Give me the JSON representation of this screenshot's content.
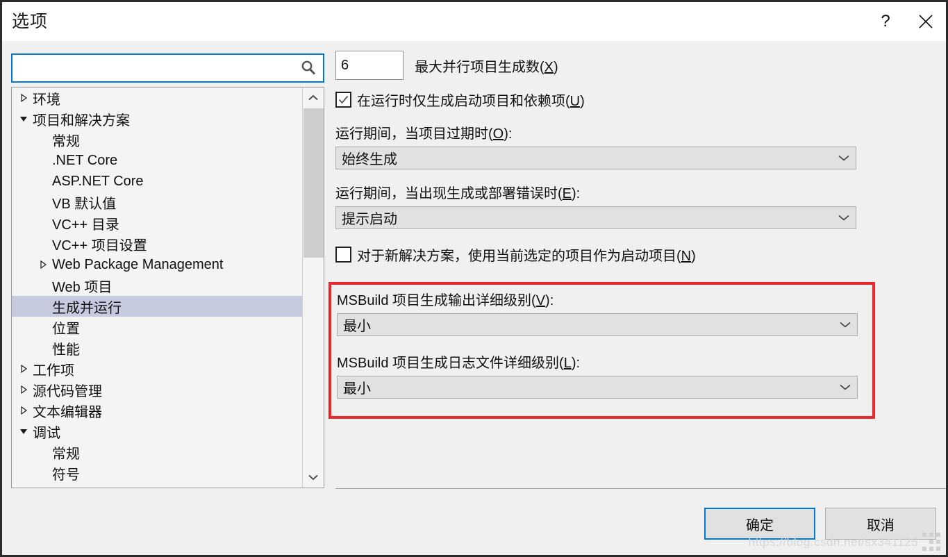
{
  "window": {
    "title": "选项",
    "help_icon": "question-mark-icon",
    "close_icon": "close-icon"
  },
  "search": {
    "value": "",
    "placeholder": "",
    "icon": "search-icon"
  },
  "tree": {
    "items": [
      {
        "label": "环境",
        "level": 0,
        "state": "collapsed",
        "selected": false
      },
      {
        "label": "项目和解决方案",
        "level": 0,
        "state": "expanded",
        "selected": false
      },
      {
        "label": "常规",
        "level": 1,
        "state": "leaf",
        "selected": false
      },
      {
        "label": ".NET Core",
        "level": 1,
        "state": "leaf",
        "selected": false
      },
      {
        "label": "ASP.NET Core",
        "level": 1,
        "state": "leaf",
        "selected": false
      },
      {
        "label": "VB 默认值",
        "level": 1,
        "state": "leaf",
        "selected": false
      },
      {
        "label": "VC++ 目录",
        "level": 1,
        "state": "leaf",
        "selected": false
      },
      {
        "label": "VC++ 项目设置",
        "level": 1,
        "state": "leaf",
        "selected": false
      },
      {
        "label": "Web Package Management",
        "level": 1,
        "state": "collapsed",
        "selected": false
      },
      {
        "label": "Web 项目",
        "level": 1,
        "state": "leaf",
        "selected": false
      },
      {
        "label": "生成并运行",
        "level": 1,
        "state": "leaf",
        "selected": true
      },
      {
        "label": "位置",
        "level": 1,
        "state": "leaf",
        "selected": false
      },
      {
        "label": "性能",
        "level": 1,
        "state": "leaf",
        "selected": false
      },
      {
        "label": "工作项",
        "level": 0,
        "state": "collapsed",
        "selected": false
      },
      {
        "label": "源代码管理",
        "level": 0,
        "state": "collapsed",
        "selected": false
      },
      {
        "label": "文本编辑器",
        "level": 0,
        "state": "collapsed",
        "selected": false
      },
      {
        "label": "调试",
        "level": 0,
        "state": "expanded",
        "selected": false
      },
      {
        "label": "常规",
        "level": 1,
        "state": "leaf",
        "selected": false
      },
      {
        "label": "符号",
        "level": 1,
        "state": "leaf",
        "selected": false
      }
    ],
    "scrollbar": {
      "up_icon": "chevron-up-icon",
      "down_icon": "chevron-down-icon"
    }
  },
  "options": {
    "max_parallel_builds": {
      "value": "6",
      "label": "最大并行项目生成数(X)",
      "accesskey": "X"
    },
    "build_only_startup": {
      "label": "在运行时仅生成启动项目和依赖项(U)",
      "accesskey": "U",
      "checked": true
    },
    "on_run_out_of_date": {
      "label": "运行期间，当项目过期时(O):",
      "accesskey": "O",
      "value": "始终生成"
    },
    "on_run_build_error": {
      "label": "运行期间，当出现生成或部署错误时(E):",
      "accesskey": "E",
      "value": "提示启动"
    },
    "new_solution_startup": {
      "label": "对于新解决方案，使用当前选定的项目作为启动项目(N)",
      "accesskey": "N",
      "checked": false
    },
    "msbuild_output_verbosity": {
      "label": "MSBuild 项目生成输出详细级别(V):",
      "accesskey": "V",
      "value": "最小"
    },
    "msbuild_log_verbosity": {
      "label": "MSBuild 项目生成日志文件详细级别(L):",
      "accesskey": "L",
      "value": "最小"
    },
    "highlight_color": "#e9272d"
  },
  "footer": {
    "ok_label": "确定",
    "cancel_label": "取消"
  },
  "watermark": {
    "text": "https://blog.csdn.net/sx341125"
  }
}
